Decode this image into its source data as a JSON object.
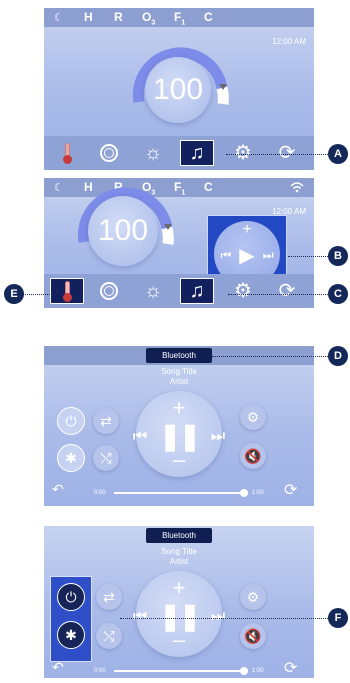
{
  "statusbar": {
    "moon_icon": "moon-icon",
    "letters": [
      "H",
      "R",
      "O",
      "F",
      "C"
    ],
    "o_sub": "3",
    "f_sub": "1"
  },
  "clock": "12:00 AM",
  "dial_value": "100",
  "bottombar": {
    "icons": [
      "thermometer-icon",
      "rings-icon",
      "sun-icon",
      "music-icon",
      "gear-icon",
      "refresh-icon"
    ]
  },
  "music": {
    "source": "Bluetooth",
    "song_title": "Song Title",
    "artist": "Artist",
    "time_start": "0:00",
    "time_end": "1:00",
    "progress": 1.0
  },
  "callouts": [
    "A",
    "B",
    "C",
    "D",
    "E",
    "F"
  ]
}
